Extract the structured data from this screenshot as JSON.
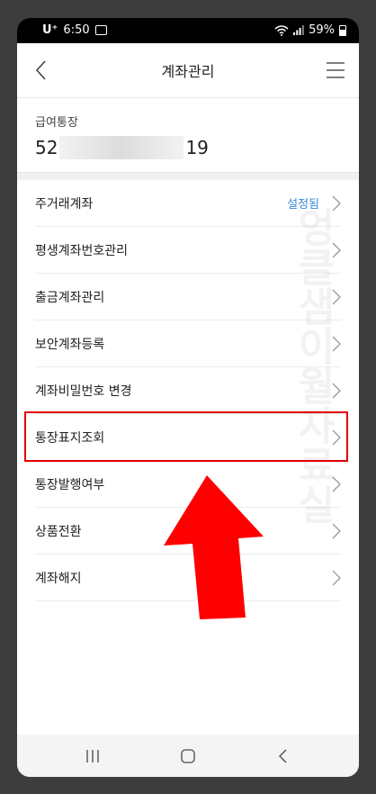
{
  "status_bar": {
    "carrier": "U⁺",
    "time": "6:50",
    "battery": "59%"
  },
  "header": {
    "title": "계좌관리"
  },
  "account": {
    "label": "급여통장",
    "number_prefix": "52",
    "number_suffix": "19"
  },
  "menu": {
    "items": [
      {
        "label": "주거래계좌",
        "status": "설정됨"
      },
      {
        "label": "평생계좌번호관리",
        "status": ""
      },
      {
        "label": "출금계좌관리",
        "status": ""
      },
      {
        "label": "보안계좌등록",
        "status": ""
      },
      {
        "label": "계좌비밀번호 변경",
        "status": ""
      },
      {
        "label": "통장표지조회",
        "status": ""
      },
      {
        "label": "통장발행여부",
        "status": ""
      },
      {
        "label": "상품전환",
        "status": ""
      },
      {
        "label": "계좌해지",
        "status": ""
      }
    ]
  },
  "watermark": "엉클샘이월자료실",
  "colors": {
    "highlight": "#e00000",
    "arrow": "#ff0000",
    "status_link": "#3b8ad9"
  }
}
